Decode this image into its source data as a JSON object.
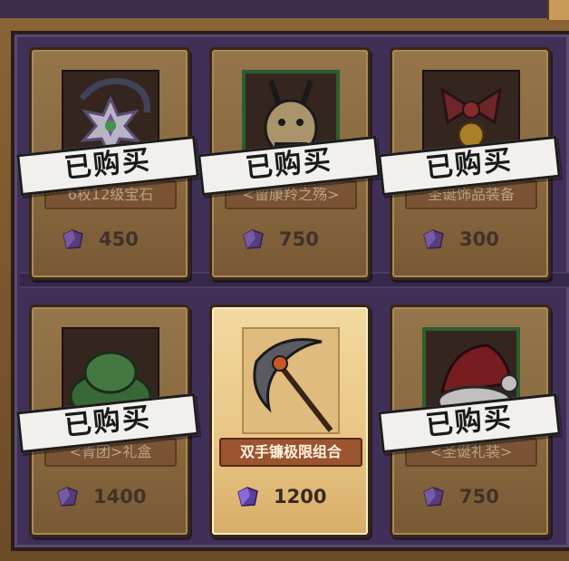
{
  "shop": {
    "items": [
      {
        "name": "6枚12级宝石",
        "price": "450",
        "sold_label": "已购买",
        "sold": true,
        "icon": "star-gem-dragon-icon"
      },
      {
        "name": "<留康羚之殇>",
        "price": "750",
        "sold_label": "已购买",
        "sold": true,
        "icon": "horned-beast-icon"
      },
      {
        "name": "圣诞饰品装备",
        "price": "300",
        "sold_label": "已购买",
        "sold": true,
        "icon": "christmas-bow-bell-icon"
      },
      {
        "name": "<青团>礼盒",
        "price": "1400",
        "sold_label": "已购买",
        "sold": true,
        "icon": "green-slime-icon"
      },
      {
        "name": "双手镰极限组合",
        "price": "1200",
        "sold_label": "",
        "sold": false,
        "icon": "scythe-icon"
      },
      {
        "name": "<圣诞礼装>",
        "price": "750",
        "sold_label": "已购买",
        "sold": true,
        "icon": "santa-hat-icon"
      }
    ],
    "currency_icon": "purple-crystal-icon",
    "colors": {
      "frame": "#8a6436",
      "panel": "#403058",
      "card": "#a07a44",
      "highlight_card": "#e8c584",
      "sold_banner": "#f2f0ec"
    }
  }
}
